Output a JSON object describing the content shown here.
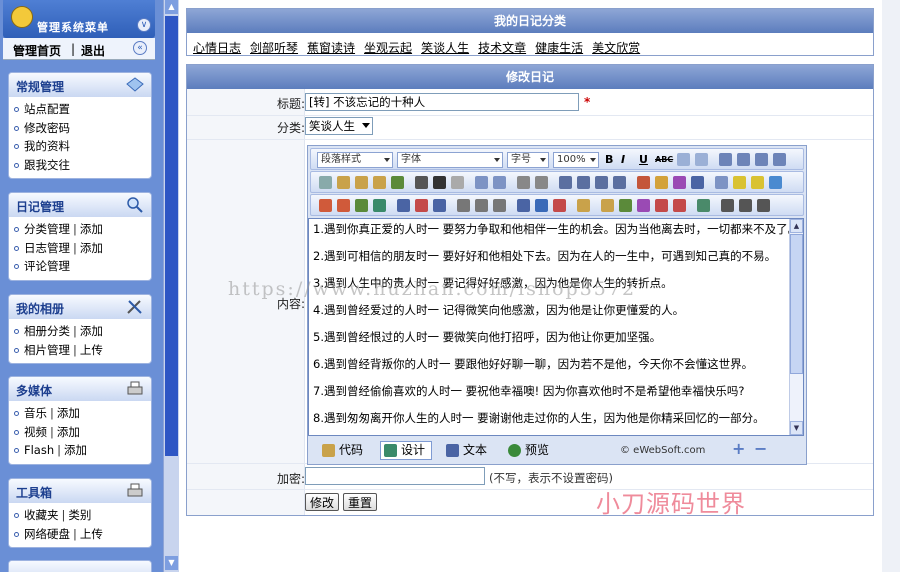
{
  "sidebar": {
    "title": "管理系统菜单",
    "home_label": "管理首页",
    "logout_label": "退出",
    "panels": [
      {
        "title": "常规管理",
        "items": [
          {
            "a": "站点配置"
          },
          {
            "a": "修改密码"
          },
          {
            "a": "我的资料"
          },
          {
            "a": "跟我交往"
          }
        ]
      },
      {
        "title": "日记管理",
        "items": [
          {
            "a": "分类管理",
            "b": "添加"
          },
          {
            "a": "日志管理",
            "b": "添加"
          },
          {
            "a": "评论管理"
          }
        ]
      },
      {
        "title": "我的相册",
        "items": [
          {
            "a": "相册分类",
            "b": "添加"
          },
          {
            "a": "相片管理",
            "b": "上传"
          }
        ]
      },
      {
        "title": "多媒体",
        "items": [
          {
            "a": "音乐",
            "b": "添加"
          },
          {
            "a": "视频",
            "b": "添加"
          },
          {
            "a": "Flash",
            "b": "添加"
          }
        ]
      },
      {
        "title": "工具箱",
        "items": [
          {
            "a": "收藏夹",
            "b": "类别"
          },
          {
            "a": "网络硬盘",
            "b": "上传"
          }
        ]
      }
    ]
  },
  "categories": {
    "header": "我的日记分类",
    "links": [
      "心情日志",
      "剑部听琴",
      "蕉窗读诗",
      "坐观云起",
      "笑谈人生",
      "技术文章",
      "健康生活",
      "美文欣赏"
    ]
  },
  "form": {
    "header": "修改日记",
    "title_label": "标题:",
    "title_value": "[转] 不该忘记的十种人",
    "required_mark": "*",
    "category_label": "分类:",
    "category_value": "笑谈人生",
    "content_label": "内容:",
    "password_label": "加密:",
    "password_hint": "(不写，表示不设置密码)",
    "submit_label": "修改",
    "reset_label": "重置"
  },
  "editor": {
    "style_select": "段落样式",
    "font_select": "字体",
    "size_select": "字号",
    "zoom_select": "100%",
    "bold": "B",
    "italic": "I",
    "underline": "U",
    "strike": "ABC",
    "content": [
      "1.遇到你真正爱的人时一 要努力争取和他相伴一生的机会。因为当他离去时，一切都来不及了。",
      "2.遇到可相信的朋友时一 要好好和他相处下去。因为在人的一生中，可遇到知己真的不易。",
      "3.遇到人生中的贵人时一 要记得好好感激，因为他是你人生的转折点。",
      "4.遇到曾经爱过的人时一 记得微笑向他感激，因为他是让你更懂爱的人。",
      "5.遇到曾经恨过的人时一 要微笑向他打招呼，因为他让你更加坚强。",
      "6.遇到曾经背叛你的人时一 要跟他好好聊一聊，因为若不是他，今天你不会懂这世界。",
      "7.遇到曾经偷偷喜欢的人时一 要祝他幸福噢! 因为你喜欢他时不是希望他幸福快乐吗?",
      "8.遇到匆匆离开你人生的人时一 要谢谢他走过你的人生，因为他是你精采回忆的一部分。"
    ],
    "modes": [
      "代码",
      "设计",
      "文本",
      "预览"
    ],
    "active_mode": "设计",
    "credit": "© eWebSoft.com"
  },
  "watermarks": {
    "url": "https://www.huzhan.com/ishop3572",
    "brand": "小刀源码世界"
  },
  "colors": {
    "sidebar_bg": "#6a8fd6",
    "header_blue": "#5c7dbd",
    "required_red": "#cc0000"
  }
}
